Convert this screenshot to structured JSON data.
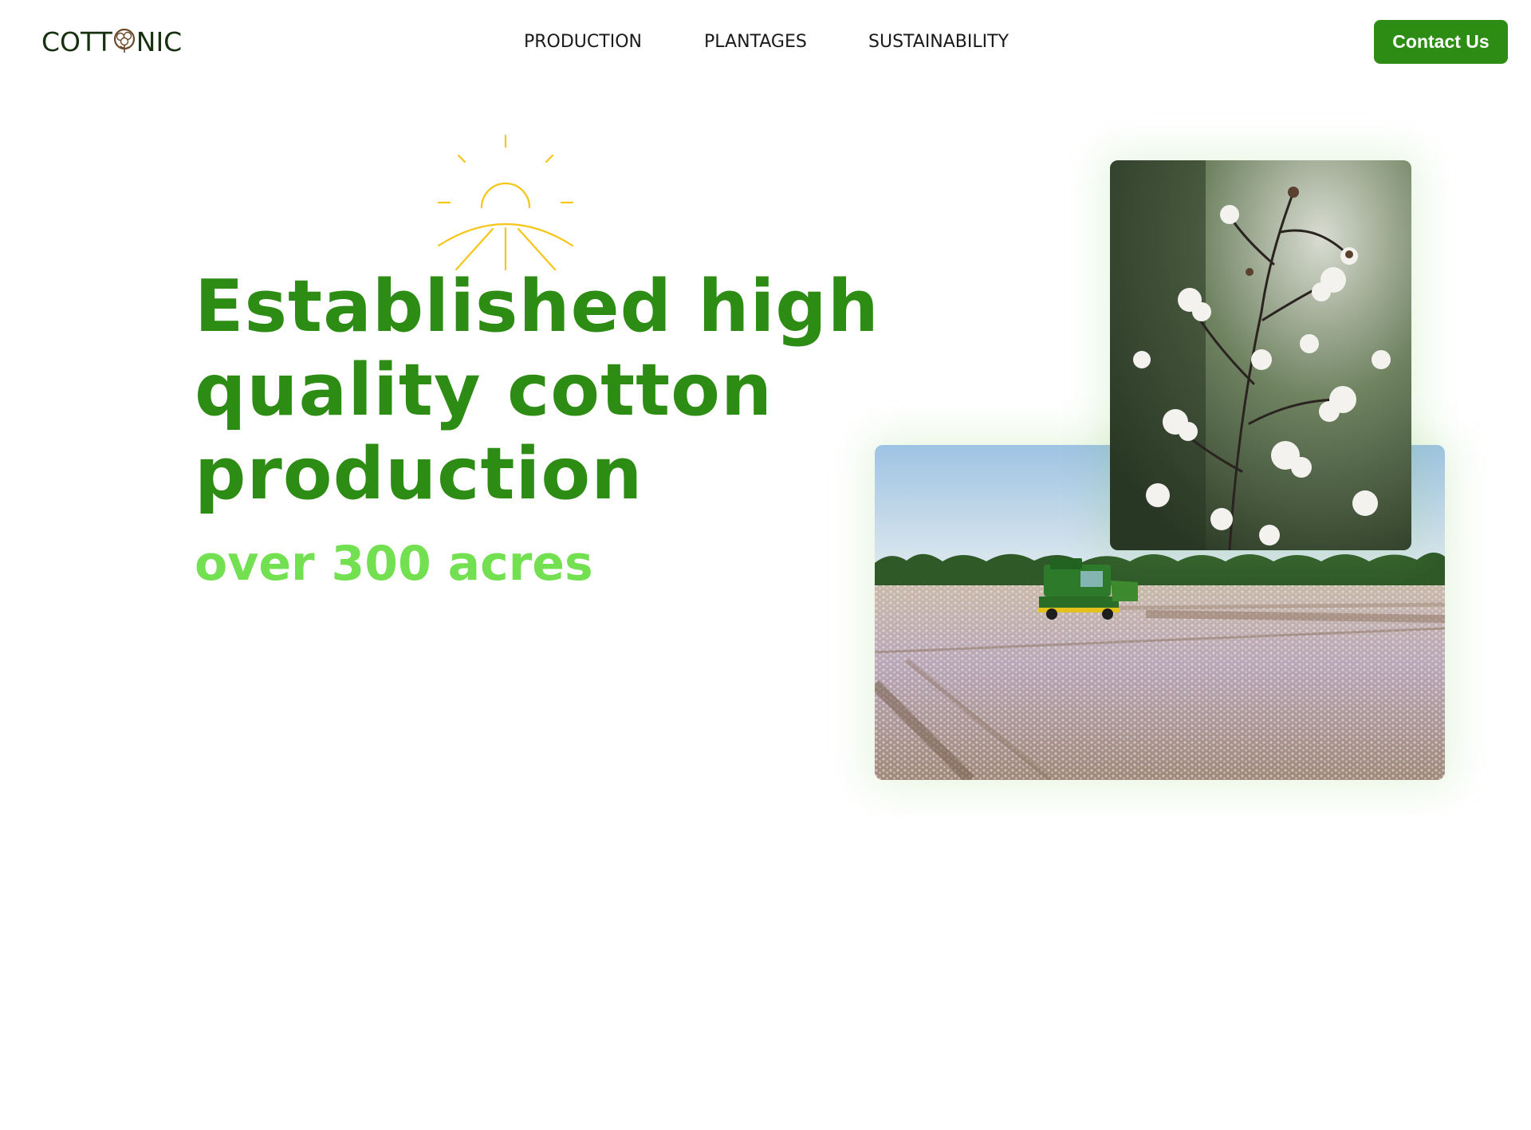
{
  "header": {
    "logo": {
      "text_left": "COTT",
      "text_right": "NIC",
      "icon": "cotton-boll-icon"
    },
    "nav": [
      {
        "label": "PRODUCTION"
      },
      {
        "label": "PLANTAGES"
      },
      {
        "label": "SUSTAINABILITY"
      }
    ],
    "cta_label": "Contact Us"
  },
  "hero": {
    "sun_icon": "sunrise-icon",
    "headline": "Established high quality cotton production",
    "subline": "over 300 acres"
  },
  "images": {
    "field_photo": "cotton-harvester-field-photo",
    "boll_photo": "cotton-plant-closeup-photo"
  },
  "colors": {
    "brand_green": "#2d8c14",
    "light_green": "#72e050",
    "logo_dark": "#17300f",
    "sun_yellow": "#f5c518"
  }
}
